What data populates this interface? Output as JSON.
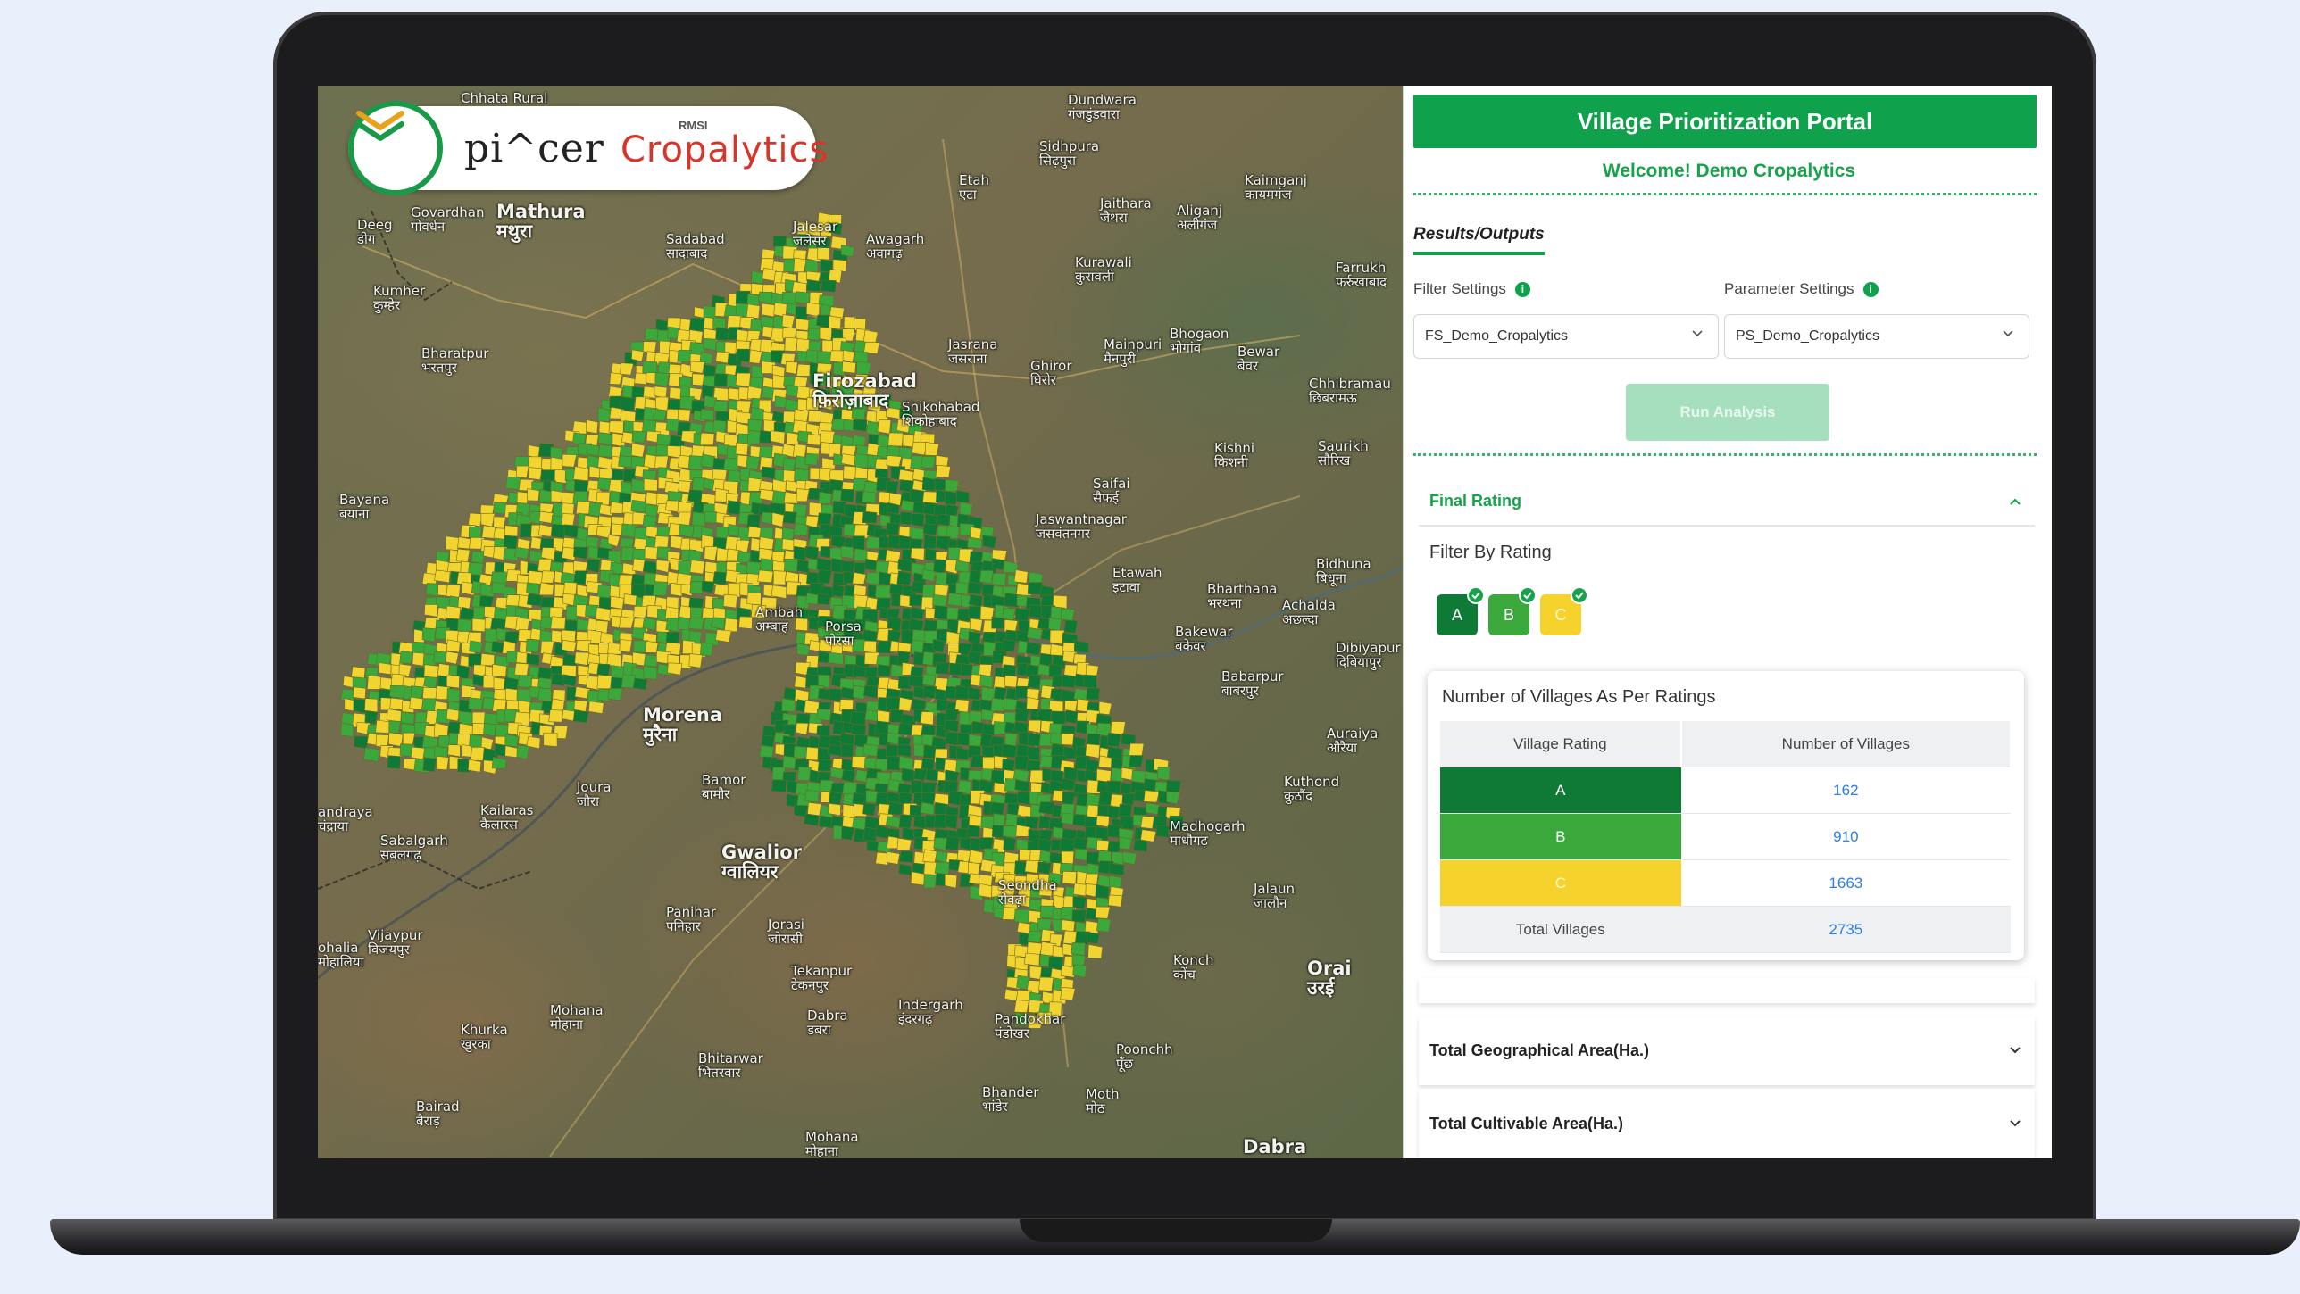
{
  "logo": {
    "brand1": "pi^cer",
    "tm": "™",
    "rmsi": "RMSI",
    "brand2": "Cropalytics"
  },
  "map": {
    "places": [
      [
        "Chhata Rural",
        160,
        6
      ],
      [
        "Dundwara\nगंजडुंडवारा",
        840,
        8
      ],
      [
        "Sidhpura\nसिढ़पुरा",
        808,
        60
      ],
      [
        "Mathura\nमथुरा",
        200,
        130,
        "big"
      ],
      [
        "Etah\nएटा",
        718,
        98
      ],
      [
        "Jaithara\nजैथरा",
        876,
        124
      ],
      [
        "Aliganj\nअलीगंज",
        962,
        132
      ],
      [
        "Kaimganj\nकायमगंज",
        1038,
        98
      ],
      [
        "Govardhan\nगोवर्धन",
        104,
        134
      ],
      [
        "Sadabad\nसादाबाद",
        390,
        164
      ],
      [
        "Jalesar\nजलेसर",
        532,
        150
      ],
      [
        "Awagarh\nअवागढ़",
        614,
        164
      ],
      [
        "Kurawali\nकुरावली",
        848,
        190
      ],
      [
        "Farrukh\nफर्रुखाबाद",
        1140,
        196
      ],
      [
        "Deeg\nडीग",
        44,
        148
      ],
      [
        "Kumher\nकुम्हेर",
        62,
        222
      ],
      [
        "Bharatpur\nभरतपुर",
        116,
        292
      ],
      [
        "Firozabad\nफ़िरोज़ाबाद",
        554,
        320,
        "big"
      ],
      [
        "Jasrana\nजसराना",
        706,
        282
      ],
      [
        "Mainpuri\nमैनपुरी",
        880,
        282
      ],
      [
        "Bhogaon\nभोगांव",
        954,
        270
      ],
      [
        "Bewar\nबेवर",
        1030,
        290
      ],
      [
        "Chhibramau\nछिबरामऊ",
        1110,
        326
      ],
      [
        "Ghiror\nघिरोर",
        798,
        306
      ],
      [
        "Shikohabad\nशिकोहाबाद",
        654,
        352
      ],
      [
        "Kishni\nकिशनी",
        1004,
        398
      ],
      [
        "Saurikh\nसौरिख",
        1120,
        396
      ],
      [
        "Bayana\nबयाना",
        24,
        456
      ],
      [
        "Saifai\nसैफई",
        868,
        438
      ],
      [
        "Jaswantnagar\nजसवंतनगर",
        804,
        478
      ],
      [
        "Etawah\nइटावा",
        890,
        538
      ],
      [
        "Bharthana\nभरथना",
        996,
        556
      ],
      [
        "Bidhuna\nबिधूना",
        1118,
        528
      ],
      [
        "Achalda\nअछल्दा",
        1080,
        574
      ],
      [
        "Bakewar\nबकेवर",
        960,
        604
      ],
      [
        "Dibiyapur\nदिबियापुर",
        1140,
        622
      ],
      [
        "Ambah\nअम्बाह",
        490,
        582
      ],
      [
        "Porsa\nपोरसा",
        568,
        598
      ],
      [
        "Babarpur\nबाबरपुर",
        1012,
        654
      ],
      [
        "Auraiya\nऔरैया",
        1130,
        718
      ],
      [
        "Morena\nमुरैना",
        364,
        694,
        "big"
      ],
      [
        "Kuthond\nकुठौंद",
        1082,
        772
      ],
      [
        "Bamor\nबामौर",
        430,
        770
      ],
      [
        "Joura\nजौरा",
        290,
        778
      ],
      [
        "Kailaras\nकैलारस",
        182,
        804
      ],
      [
        "Madhogarh\nमाधौगढ़",
        954,
        822
      ],
      [
        "Sabalgarh\nसबलगढ़",
        70,
        838
      ],
      [
        "andraya\nचंद्राया",
        0,
        806
      ],
      [
        "Gwalior\nग्वालियर",
        452,
        848,
        "big"
      ],
      [
        "Seondha\nसेवढ़ा",
        762,
        888
      ],
      [
        "Jalaun\nजालौन",
        1048,
        892
      ],
      [
        "Panihar\nपनिहार",
        390,
        918
      ],
      [
        "Jorasi\nजोरासी",
        504,
        932
      ],
      [
        "Vijaypur\nविजयपुर",
        56,
        944
      ],
      [
        "Konch\nकोंच",
        958,
        972
      ],
      [
        "Orai\nउरई",
        1108,
        978,
        "big"
      ],
      [
        "Tekanpur\nटेकनपुर",
        530,
        984
      ],
      [
        "ohalia\nमोहालिया",
        0,
        958
      ],
      [
        "Mohana\nमोहाना",
        260,
        1028
      ],
      [
        "Dabra\nडबरा",
        548,
        1034
      ],
      [
        "Indergarh\nइंदरगढ़",
        650,
        1022
      ],
      [
        "Pandokhar\nपंडोखर",
        758,
        1038
      ],
      [
        "Khurka\nखुरका",
        160,
        1050
      ],
      [
        "Bhitarwar\nभितरवार",
        426,
        1082
      ],
      [
        "Poonchh\nपूँछ",
        894,
        1072
      ],
      [
        "Bhander\nभांडेर",
        744,
        1120
      ],
      [
        "Moth\nमोठ",
        860,
        1122
      ],
      [
        "Bairad\nबैराड़",
        110,
        1136
      ],
      [
        "Mohana\nमोहाना",
        546,
        1170
      ],
      [
        "Dabra",
        1036,
        1178,
        "big"
      ],
      [
        "इंदरगढ़",
        1230,
        1184
      ]
    ]
  },
  "panel": {
    "title": "Village Prioritization Portal",
    "welcome": "Welcome! Demo Cropalytics",
    "tab": "Results/Outputs",
    "filter_settings_label": "Filter Settings",
    "parameter_settings_label": "Parameter Settings",
    "filter_value": "FS_Demo_Cropalytics",
    "parameter_value": "PS_Demo_Cropalytics",
    "run_button": "Run Analysis",
    "final_rating": "Final Rating",
    "filter_by_rating": "Filter By Rating",
    "chips": [
      {
        "label": "A",
        "color": "#0f7a35"
      },
      {
        "label": "B",
        "color": "#3aa83a"
      },
      {
        "label": "C",
        "color": "#f5d22c"
      }
    ],
    "table_title": "Number of Villages As Per Ratings",
    "table_headers": [
      "Village Rating",
      "Number of Villages"
    ],
    "rows": [
      {
        "rating": "A",
        "count": "162",
        "color": "#0f7a35"
      },
      {
        "rating": "B",
        "count": "910",
        "color": "#3aa83a"
      },
      {
        "rating": "C",
        "count": "1663",
        "color": "#f5d22c"
      }
    ],
    "total_label": "Total Villages",
    "total_count": "2735",
    "geo_area": "Total Geographical Area(Ha.)",
    "cult_area": "Total Cultivable Area(Ha.)"
  },
  "bottom_labels": {
    "dabra": "Dabra",
    "pandokhar": "Pandokhar",
    "indergarh": "इंदरगढ़"
  }
}
